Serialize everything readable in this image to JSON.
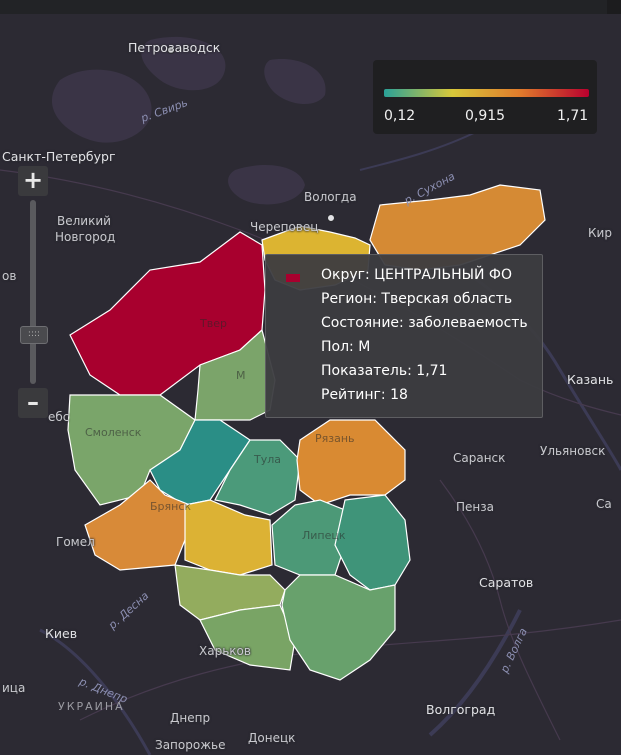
{
  "legend": {
    "min_label": "0,12",
    "mid_label": "0,915",
    "max_label": "1,71",
    "gradient_colors": [
      "#2aa198",
      "#d8c83a",
      "#e07a2c",
      "#b8002e"
    ]
  },
  "zoom": {
    "plus_symbol": "+",
    "minus_symbol": "–",
    "handle_symbol": "::::"
  },
  "tooltip": {
    "swatch_color": "#a8002e",
    "district": "Округ: ЦЕНТРАЛЬНЫЙ ФО",
    "region": "Регион: Тверская область",
    "state": "Состояние: заболеваемость",
    "sex": "Пол: М",
    "indicator": "Показатель: 1,71",
    "rating": "Рейтинг: 18"
  },
  "cities": {
    "petrozavodsk": "Петрозаводск",
    "spb": "Санкт-Петербург",
    "vologda": "Вологда",
    "cherepovets": "Череповец",
    "veliky_novgorod_1": "Великий",
    "veliky_novgorod_2": "Новгород",
    "kirov_partial": "Кир",
    "kazan": "Казань",
    "ulyanovsk": "Ульяновск",
    "saransk": "Саранск",
    "penza": "Пенза",
    "saratov": "Саратов",
    "samara_partial": "Са",
    "kiev": "Киев",
    "gomel": "Гомел",
    "kharkov": "Харьков",
    "volgograd": "Волгоград",
    "dnepr": "Днепр",
    "donetsk": "Донецк",
    "zaporozhye": "Запорожье",
    "vitebsk_partial": "ебс",
    "left_partial_1": "ов",
    "left_partial_2": "ица",
    "tver_ghost": "Твер",
    "smolensk_ghost": "Смоленск",
    "tula_ghost": "Тула",
    "ryazan_ghost": "Рязань",
    "bryansk_ghost": "Брянск",
    "lipetsk_ghost": "Липецк",
    "m_ghost": "М"
  },
  "rivers": {
    "svir": "р. Свирь",
    "sukhona": "р. Сухона",
    "desna": "р. Десна",
    "dnepr_river": "р. Днепр",
    "volga": "р. Волга"
  },
  "countries": {
    "ukraine": "УКРАИНА"
  },
  "region_colors": {
    "tver": "#a8002e",
    "yaroslavl": "#dcb431",
    "kostroma": "#d58a34",
    "smolensk": "#7aa56a",
    "moscow": "#7ba46a",
    "kaluga": "#2a8e86",
    "tula": "#4b9a7a",
    "ryazan": "#d98a32",
    "bryansk": "#d88a38",
    "orel": "#dcb234",
    "lipetsk": "#4c9977",
    "tambov": "#3f9479",
    "kursk": "#93ac5e",
    "belgorod": "#79a465",
    "voronezh": "#68a16c"
  }
}
